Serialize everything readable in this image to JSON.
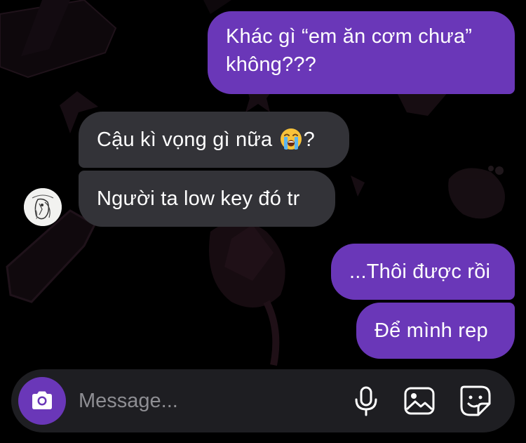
{
  "conversation": {
    "messages": [
      {
        "direction": "outgoing",
        "text": "Khác gì “em ăn cơm chưa” không???"
      },
      {
        "direction": "incoming",
        "text_before_emoji": "Cậu kì vọng gì nữa ",
        "emoji": "loudly-crying-face",
        "text_after_emoji": "?"
      },
      {
        "direction": "incoming",
        "text": "Người ta low key đó tr"
      },
      {
        "direction": "outgoing",
        "text": "...Thôi được rồi"
      },
      {
        "direction": "outgoing",
        "text": "Để mình rep"
      }
    ]
  },
  "composer": {
    "placeholder": "Message...",
    "value": "",
    "icons": [
      "camera-icon",
      "microphone-icon",
      "gallery-icon",
      "sticker-icon"
    ]
  },
  "theme": {
    "outgoing_bubble": "#6a37b8",
    "incoming_bubble": "#333338",
    "background": "#000000",
    "composer_background": "#1e1e22",
    "placeholder_color": "#8e8e93"
  }
}
